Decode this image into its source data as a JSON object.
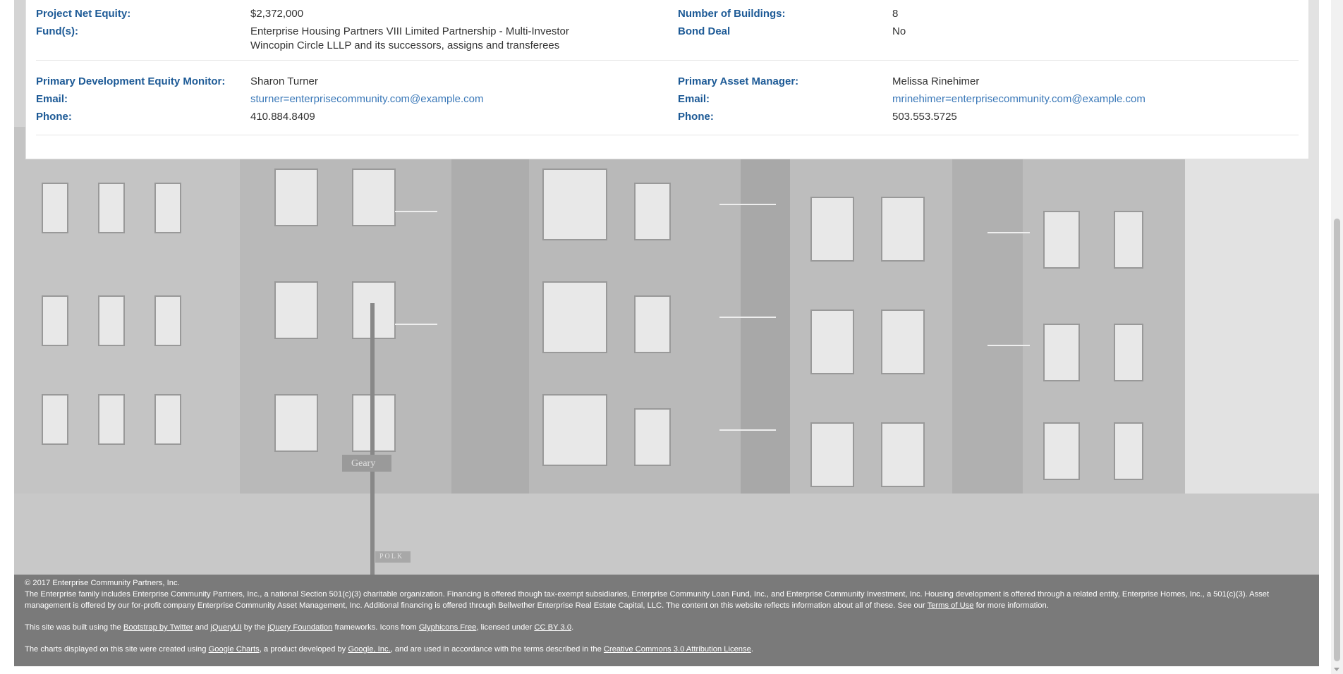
{
  "details": {
    "net_equity_label": "Project Net Equity:",
    "net_equity_value": "$2,372,000",
    "funds_label": "Fund(s):",
    "funds_line1": "Enterprise Housing Partners VIII Limited Partnership - Multi-Investor",
    "funds_line2": "Wincopin Circle LLLP and its successors, assigns and transferees",
    "buildings_label": "Number of Buildings:",
    "buildings_value": "8",
    "bond_label": "Bond Deal",
    "bond_value": "No"
  },
  "contacts": {
    "monitor_label": "Primary Development Equity Monitor:",
    "monitor_name": "Sharon Turner",
    "monitor_email_label": "Email:",
    "monitor_email": "sturner=enterprisecommunity.com@example.com",
    "monitor_phone_label": "Phone:",
    "monitor_phone": "410.884.8409",
    "manager_label": "Primary Asset Manager:",
    "manager_name": "Melissa Rinehimer",
    "manager_email_label": "Email:",
    "manager_email": "mrinehimer=enterprisecommunity.com@example.com",
    "manager_phone_label": "Phone:",
    "manager_phone": "503.553.5725"
  },
  "background": {
    "sign1": "Geary",
    "sign2": "POLK"
  },
  "footer": {
    "copyright": "© 2017 Enterprise Community Partners, Inc.",
    "family_text_a": "The Enterprise family includes Enterprise Community Partners, Inc., a national Section 501(c)(3) charitable organization. Financing is offered though tax-exempt subsidiaries, Enterprise Community Loan Fund, Inc., and Enterprise Community Investment, Inc. Housing development is offered through a related entity, Enterprise Homes, Inc., a 501(c)(3). Asset management is offered by our for-profit company Enterprise Community Asset Management, Inc. Additional financing is offered through Bellwether Enterprise Real Estate Capital, LLC. The content on this website reflects information about all of these. See our ",
    "terms_link": "Terms of Use",
    "family_text_b": " for more information.",
    "built_a": "This site was built using the ",
    "bootstrap_link": "Bootstrap by Twitter",
    "built_b": " and ",
    "jqueryui_link": "jQueryUI",
    "built_c": " by the ",
    "jquery_foundation_link": "jQuery Foundation",
    "built_d": " frameworks. Icons from ",
    "glyphicons_link": "Glyphicons Free",
    "built_e": ", licensed under ",
    "ccby_link": "CC BY 3.0",
    "built_f": ".",
    "charts_a": "The charts displayed on this site were created using ",
    "google_charts_link": "Google Charts",
    "charts_b": ", a product developed by ",
    "google_inc_link": "Google, Inc.",
    "charts_c": ", and are used in accordance with the terms described in the ",
    "cc_attr_link": "Creative Commons 3.0 Attribution License",
    "charts_d": "."
  }
}
